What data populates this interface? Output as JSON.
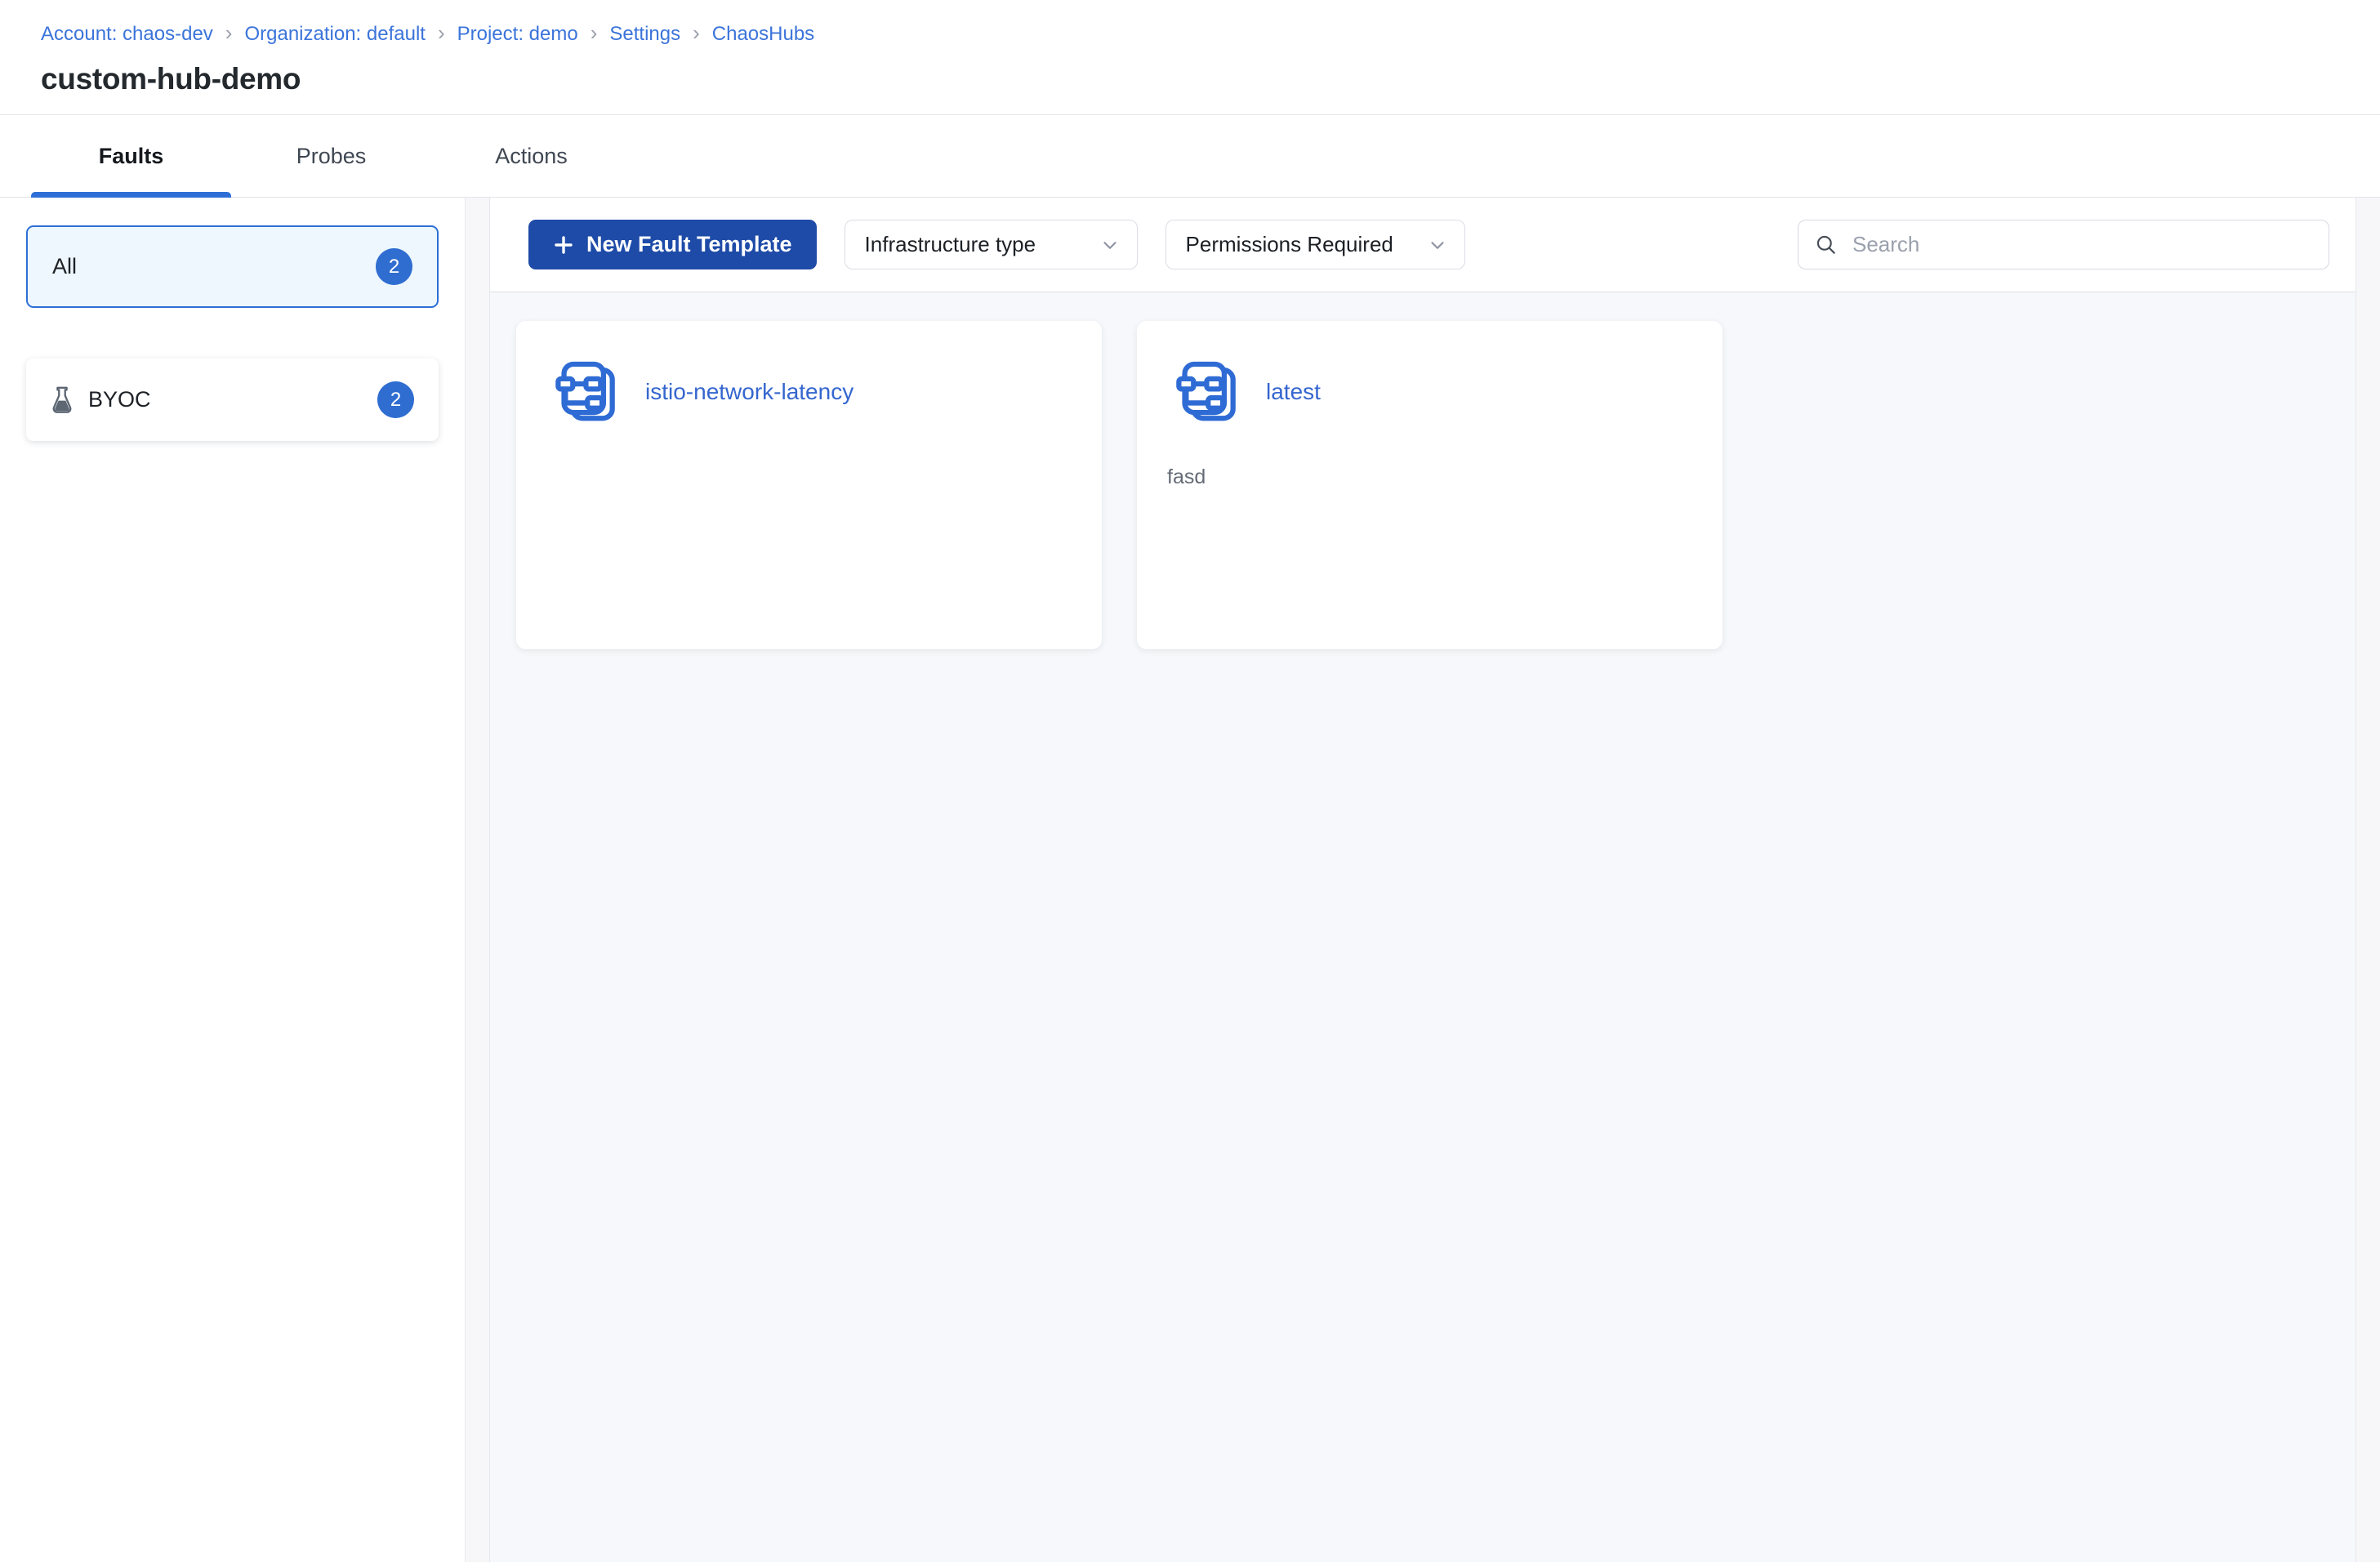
{
  "colors": {
    "primary_blue": "#2d6fd6",
    "button_blue": "#1e4ba8",
    "link_blue": "#3566cf",
    "badge_blue": "#2f6dd1",
    "content_background": "#f6f8fb"
  },
  "breadcrumb": {
    "separator": "›",
    "items": [
      {
        "label": "Account: chaos-dev"
      },
      {
        "label": "Organization: default"
      },
      {
        "label": "Project: demo"
      },
      {
        "label": "Settings"
      },
      {
        "label": "ChaosHubs"
      }
    ]
  },
  "page": {
    "title": "custom-hub-demo"
  },
  "tabs": [
    {
      "label": "Faults"
    },
    {
      "label": "Probes"
    },
    {
      "label": "Actions"
    }
  ],
  "sidebar": {
    "all": {
      "label": "All",
      "count": "2"
    },
    "byoc": {
      "label": "BYOC",
      "count": "2",
      "icon": "flask-icon"
    }
  },
  "toolbar": {
    "new_button": "New Fault Template",
    "infra_filter": "Infrastructure type",
    "perm_filter": "Permissions Required",
    "search_placeholder": "Search"
  },
  "cards": [
    {
      "title": "istio-network-latency",
      "description": "",
      "icon": "fault-template-icon"
    },
    {
      "title": "latest",
      "description": "fasd",
      "icon": "fault-template-icon"
    }
  ]
}
